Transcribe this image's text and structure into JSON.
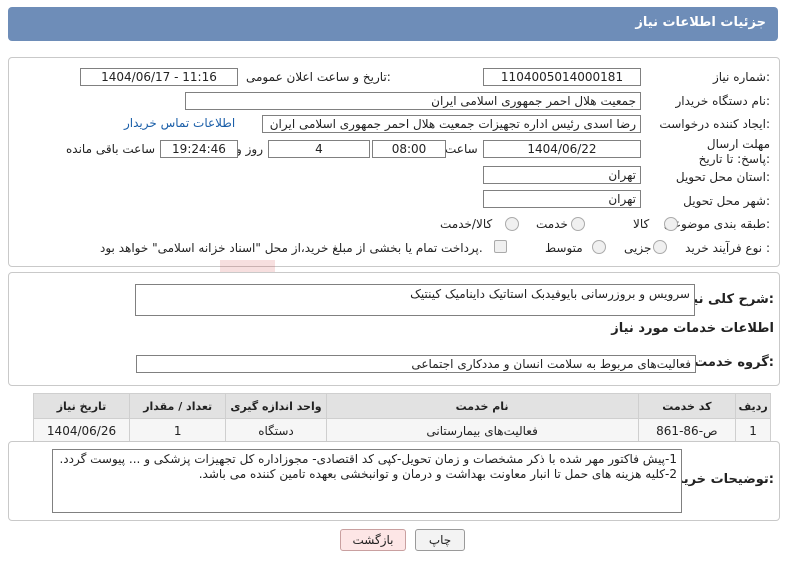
{
  "header": {
    "title": "جزئیات اطلاعات نیاز"
  },
  "fields": {
    "need_number_label": "شماره نیاز:",
    "need_number": "1104005014000181",
    "announce_label": "تاریخ و ساعت اعلان عمومی:",
    "announce_value": "1404/06/17 - 11:16",
    "buyer_org_label": "نام دستگاه خریدار:",
    "buyer_org": "جمعیت هلال احمر جمهوری اسلامی ایران",
    "requester_label": "ایجاد کننده درخواست:",
    "requester": "رضا اسدی رئیس اداره تجهیزات جمعیت هلال احمر جمهوری اسلامی ایران",
    "buyer_contact_link": "اطلاعات تماس خریدار",
    "deadline_label": "مهلت ارسال پاسخ: تا تاریخ:",
    "deadline_date": "1404/06/22",
    "time_label": "ساعت",
    "deadline_time": "08:00",
    "days_value": "4",
    "days_label": "روز و",
    "remaining_time": "19:24:46",
    "remaining_label": "ساعت باقی مانده",
    "province_label": "استان محل تحویل:",
    "province": "تهران",
    "city_label": "شهر محل تحویل:",
    "city": "تهران",
    "category_label": "طبقه بندی موضوعی:",
    "category_options": [
      "کالا",
      "خدمت",
      "کالا/خدمت"
    ],
    "purchase_type_label": "نوع فرآیند خرید :",
    "purchase_options": [
      "جزیی",
      "متوسط"
    ],
    "payment_note": "پرداخت تمام یا بخشی از مبلغ خرید،از محل \"اسناد خزانه اسلامی\" خواهد بود."
  },
  "description": {
    "label": "شرح کلی نیاز:",
    "value": "سرویس و بروزرسانی بایوفیدبک استاتیک داینامیک کینتیک"
  },
  "services": {
    "section_title": "اطلاعات خدمات مورد نیاز",
    "group_label": "گروه خدمت:",
    "group_value": "فعالیت‌های مربوط به سلامت انسان و مددکاری اجتماعی",
    "columns": [
      "ردیف",
      "کد خدمت",
      "نام خدمت",
      "واحد اندازه گیری",
      "تعداد / مقدار",
      "تاریخ نیاز"
    ],
    "rows": [
      [
        "1",
        "ص-86-861",
        "فعالیت‌های بیمارستانی",
        "دستگاه",
        "1",
        "1404/06/26"
      ]
    ]
  },
  "buyer_notes": {
    "label": "توضیحات خریدار:",
    "line1": "1-پیش فاکتور مهر شده با ذکر مشخصات و زمان تحویل-کپی کد اقتصادی- مجوزاداره کل تجهیزات پزشکی و ... پیوست گردد.",
    "line2": "2-کلیه هزینه های حمل تا انبار معاونت بهداشت و درمان و توانبخشی بعهده تامین کننده می باشد."
  },
  "buttons": {
    "print": "چاپ",
    "back": "بازگشت"
  },
  "watermark": {
    "text": "AriaTender.net"
  }
}
